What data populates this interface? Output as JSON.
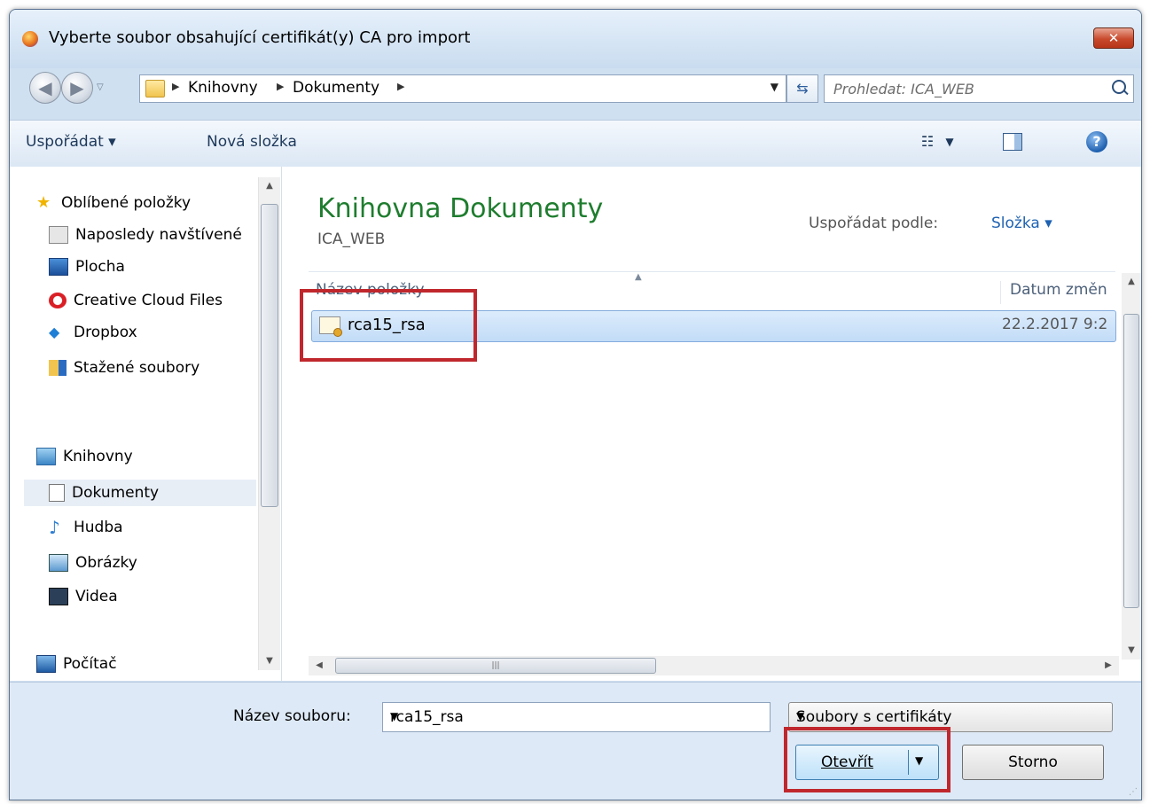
{
  "window": {
    "title": "Vyberte soubor obsahující certifikát(y) CA pro import",
    "close": "✕"
  },
  "address": {
    "crumbs": [
      "Knihovny",
      "Dokumenty"
    ]
  },
  "search": {
    "placeholder": "Prohledat: ICA_WEB"
  },
  "toolbar": {
    "organize": "Uspořádat ▾",
    "new_folder": "Nová složka"
  },
  "nav": {
    "favorites": "Oblíbené položky",
    "fav_items": [
      "Naposledy navštívené",
      "Plocha",
      "Creative Cloud Files",
      "Dropbox",
      "Stažené soubory"
    ],
    "libraries": "Knihovny",
    "lib_items": [
      "Dokumenty",
      "Hudba",
      "Obrázky",
      "Videa"
    ],
    "computer": "Počítač"
  },
  "library": {
    "title": "Knihovna Dokumenty",
    "subtitle": "ICA_WEB",
    "arrange_label": "Uspořádat podle:",
    "arrange_value": "Složka ▾"
  },
  "columns": {
    "name": "Název položky",
    "date": "Datum změn"
  },
  "files": [
    {
      "name": "rca15_rsa",
      "date": "22.2.2017 9:2"
    }
  ],
  "bottom": {
    "filename_label": "Název souboru:",
    "filename_value": "rca15_rsa",
    "filetype": "Soubory s certifikáty",
    "open": "Otevřít",
    "cancel": "Storno"
  }
}
